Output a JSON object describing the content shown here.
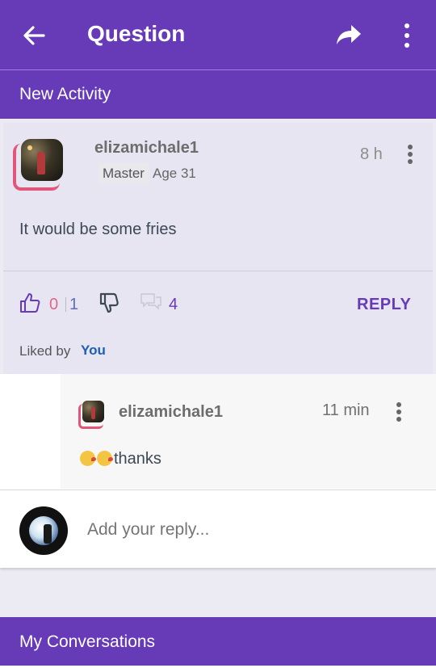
{
  "appbar": {
    "title": "Question",
    "icons": {
      "back": "arrow-left-icon",
      "share": "share-arrow-icon",
      "more": "more-vertical-icon"
    },
    "background": "#673ab7"
  },
  "sections": {
    "new_activity": "New Activity",
    "my_conversations": "My Conversations"
  },
  "post": {
    "username": "elizamichale1",
    "badge": "Master",
    "age": "Age 31",
    "time": "8 h",
    "text": "It would be some fries",
    "likes": "0",
    "score": "1",
    "comments": "4",
    "reply_label": "REPLY",
    "liked_by_label": "Liked by",
    "liked_by_user": "You"
  },
  "reply": {
    "username": "elizamichale1",
    "time": "11 min",
    "text": "thanks",
    "emojis": [
      "kissing-face-emoji",
      "kissing-face-emoji"
    ]
  },
  "composer": {
    "placeholder": "Add your reply..."
  },
  "colors": {
    "primary": "#673ab7",
    "like_pink": "#e06686",
    "link_blue": "#1d5fb3"
  }
}
